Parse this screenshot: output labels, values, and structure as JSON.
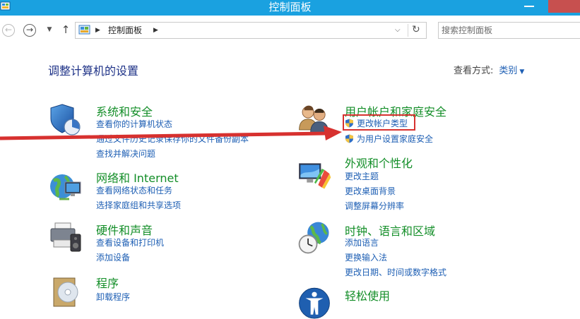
{
  "window": {
    "title": "控制面板"
  },
  "address": {
    "crumb": "控制面板"
  },
  "search": {
    "placeholder": "搜索控制面板"
  },
  "header": {
    "page_title": "调整计算机的设置",
    "view_by_label": "查看方式:",
    "view_by_value": "类别"
  },
  "categories": {
    "system": {
      "title": "系统和安全",
      "links": [
        "查看你的计算机状态",
        "通过文件历史记录保存你的文件备份副本",
        "查找并解决问题"
      ]
    },
    "network": {
      "title": "网络和 Internet",
      "links": [
        "查看网络状态和任务",
        "选择家庭组和共享选项"
      ]
    },
    "hardware": {
      "title": "硬件和声音",
      "links": [
        "查看设备和打印机",
        "添加设备"
      ]
    },
    "programs": {
      "title": "程序",
      "links": [
        "卸载程序"
      ]
    },
    "users": {
      "title": "用户帐户和家庭安全",
      "links": [
        "更改帐户类型",
        "为用户设置家庭安全"
      ]
    },
    "appearance": {
      "title": "外观和个性化",
      "links": [
        "更改主题",
        "更改桌面背景",
        "调整屏幕分辨率"
      ]
    },
    "clock": {
      "title": "时钟、语言和区域",
      "links": [
        "添加语言",
        "更换输入法",
        "更改日期、时间或数字格式"
      ]
    },
    "ease": {
      "title": "轻松使用"
    }
  },
  "colors": {
    "titlebar": "#1aa1e0",
    "category_title": "#138e28",
    "link": "#1e5fb4",
    "annotation": "#d7312f"
  }
}
